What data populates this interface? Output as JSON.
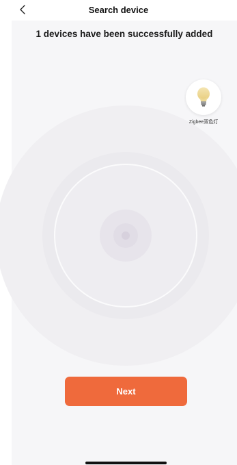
{
  "header": {
    "title": "Search device",
    "back_icon": "chevron-left-icon"
  },
  "status": {
    "message": "1 devices have been successfully added"
  },
  "devices": [
    {
      "name": "Zigbee双色灯",
      "icon": "light-bulb-icon"
    }
  ],
  "actions": {
    "next_label": "Next"
  },
  "colors": {
    "accent": "#ef6a3c",
    "background": "#f6f6f8"
  }
}
